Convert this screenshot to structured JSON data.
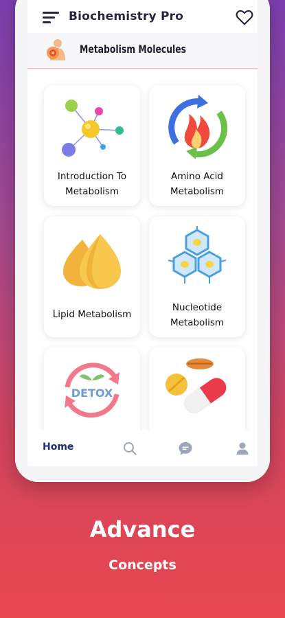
{
  "app": {
    "title": "Biochemistry Pro"
  },
  "section": {
    "title": "Metabolism Molecules"
  },
  "cards": [
    {
      "label": "Introduction To Metabolism",
      "icon": "molecule-network-icon"
    },
    {
      "label": "Amino Acid Metabolism",
      "icon": "flame-cycle-icon"
    },
    {
      "label": "Lipid Metabolism",
      "icon": "lipid-droplets-icon"
    },
    {
      "label": "Nucleotide Metabolism",
      "icon": "hexagon-cells-icon"
    },
    {
      "label": "DETOX",
      "icon": "detox-cycle-icon"
    },
    {
      "label": "",
      "icon": "pills-icon"
    }
  ],
  "nav": {
    "home_label": "Home"
  },
  "promo": {
    "title": "Advance",
    "subtitle": "Concepts"
  },
  "colors": {
    "nav_active": "#1c2f74",
    "background_top": "#7a3fb0",
    "background_bottom": "#e8474e"
  }
}
